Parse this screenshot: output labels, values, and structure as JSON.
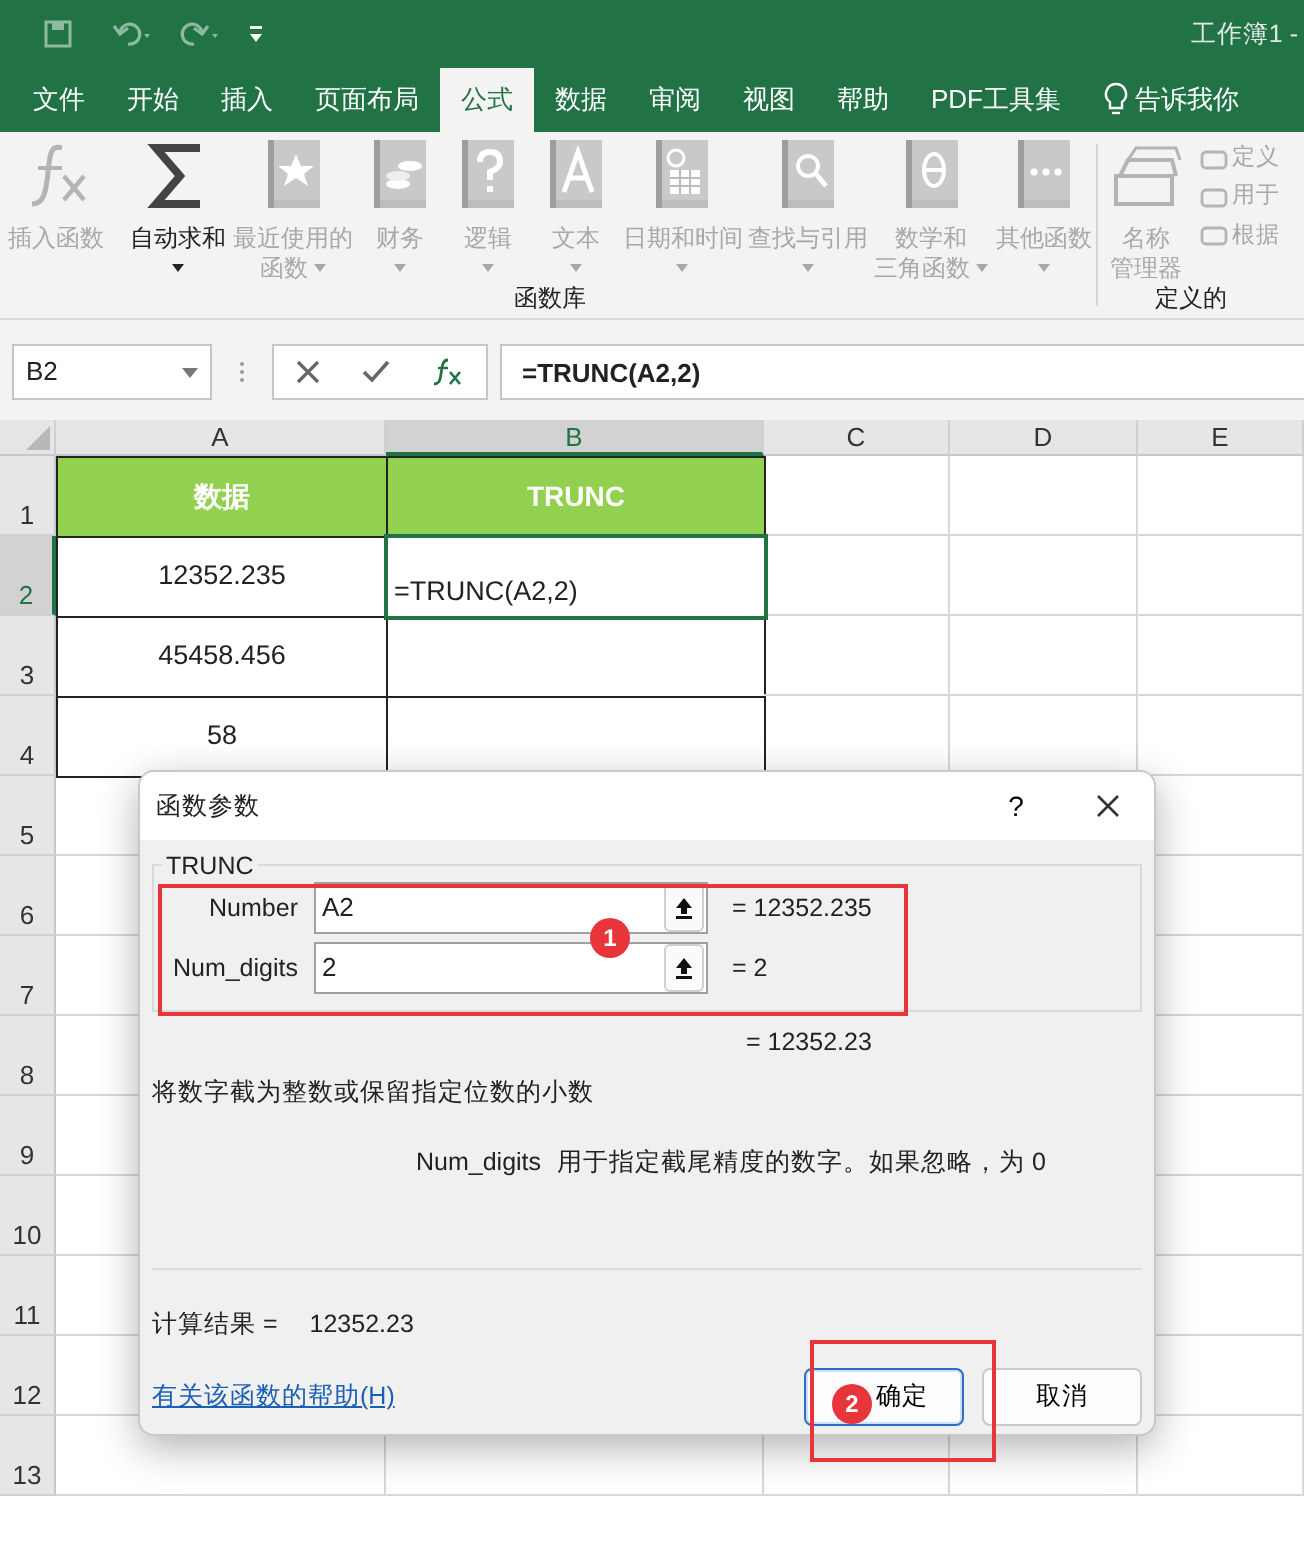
{
  "title_bar": {
    "title": "工作簿1 -"
  },
  "tabs": [
    {
      "label": "文件",
      "selected": false
    },
    {
      "label": "开始",
      "selected": false
    },
    {
      "label": "插入",
      "selected": false
    },
    {
      "label": "页面布局",
      "selected": false
    },
    {
      "label": "公式",
      "selected": true
    },
    {
      "label": "数据",
      "selected": false
    },
    {
      "label": "审阅",
      "selected": false
    },
    {
      "label": "视图",
      "selected": false
    },
    {
      "label": "帮助",
      "selected": false
    },
    {
      "label": "PDF工具集",
      "selected": false
    }
  ],
  "tell_me": {
    "label": "告诉我你"
  },
  "ribbon": {
    "groups": [
      {
        "label": "函数库",
        "buttons": [
          {
            "lines": [
              "插入函数"
            ],
            "disabled": true,
            "dropdown": false
          },
          {
            "lines": [
              "自动求和"
            ],
            "disabled": false,
            "dropdown": true
          },
          {
            "lines": [
              "最近使用的",
              "函数"
            ],
            "disabled": true,
            "dropdown": true
          },
          {
            "lines": [
              "财务"
            ],
            "disabled": true,
            "dropdown": true
          },
          {
            "lines": [
              "逻辑"
            ],
            "disabled": true,
            "dropdown": true
          },
          {
            "lines": [
              "文本"
            ],
            "disabled": true,
            "dropdown": true
          },
          {
            "lines": [
              "日期和时间"
            ],
            "disabled": true,
            "dropdown": true
          },
          {
            "lines": [
              "查找与引用"
            ],
            "disabled": true,
            "dropdown": true
          },
          {
            "lines": [
              "数学和",
              "三角函数"
            ],
            "disabled": true,
            "dropdown": true
          },
          {
            "lines": [
              "其他函数"
            ],
            "disabled": true,
            "dropdown": true
          }
        ]
      },
      {
        "label": "定义的",
        "buttons": [
          {
            "lines": [
              "名称",
              "管理器"
            ],
            "disabled": true,
            "dropdown": false
          }
        ],
        "small_buttons": [
          {
            "label": "定义",
            "disabled": true
          },
          {
            "label": "用于",
            "disabled": true
          },
          {
            "label": "根据",
            "disabled": true
          }
        ]
      }
    ]
  },
  "formula_bar": {
    "name_box": "B2",
    "formula": "=TRUNC(A2,2)"
  },
  "columns": [
    {
      "label": "A",
      "selected": false
    },
    {
      "label": "B",
      "selected": true
    },
    {
      "label": "C",
      "selected": false
    },
    {
      "label": "D",
      "selected": false
    },
    {
      "label": "E",
      "selected": false
    }
  ],
  "rows": [
    {
      "number": "1",
      "selected": false,
      "framed": true,
      "cells": [
        {
          "text": "数据",
          "kind": "header"
        },
        {
          "text": "TRUNC",
          "kind": "header"
        }
      ]
    },
    {
      "number": "2",
      "selected": true,
      "framed": true,
      "cells": [
        {
          "text": "12352.235",
          "kind": "value"
        },
        {
          "text": "=TRUNC(A2,2)",
          "kind": "editing",
          "selected": true
        }
      ]
    },
    {
      "number": "3",
      "selected": false,
      "framed": true,
      "cells": [
        {
          "text": "45458.456",
          "kind": "value"
        }
      ]
    },
    {
      "number": "4",
      "selected": false,
      "framed": true,
      "cells": [
        {
          "text": "58",
          "kind": "value"
        }
      ]
    },
    {
      "number": "5",
      "selected": false,
      "framed": false,
      "cells": []
    },
    {
      "number": "6",
      "selected": false,
      "framed": false,
      "cells": []
    },
    {
      "number": "7",
      "selected": false,
      "framed": false,
      "cells": []
    },
    {
      "number": "8",
      "selected": false,
      "framed": false,
      "cells": []
    },
    {
      "number": "9",
      "selected": false,
      "framed": false,
      "cells": []
    },
    {
      "number": "10",
      "selected": false,
      "framed": false,
      "cells": []
    },
    {
      "number": "11",
      "selected": false,
      "framed": false,
      "cells": []
    },
    {
      "number": "12",
      "selected": false,
      "framed": false,
      "cells": []
    },
    {
      "number": "13",
      "selected": false,
      "framed": false,
      "cells": []
    }
  ],
  "dialog": {
    "title": "函数参数",
    "help_button": "?",
    "function_name": "TRUNC",
    "arguments": [
      {
        "label": "Number",
        "value": "A2",
        "result": "= 12352.235"
      },
      {
        "label": "Num_digits",
        "value": "2",
        "result": "= 2"
      }
    ],
    "formula_result": "= 12352.23",
    "description": "将数字截为整数或保留指定位数的小数",
    "argument_help": {
      "name": "Num_digits",
      "text": "用于指定截尾精度的数字。如果忽略，为 0"
    },
    "calc_result_label": "计算结果 =",
    "calc_result": "12352.23",
    "help_link": "有关该函数的帮助(H)",
    "buttons": [
      {
        "label": "确定",
        "default": true
      },
      {
        "label": "取消",
        "default": false
      }
    ]
  },
  "annotations": [
    {
      "label": "1"
    },
    {
      "label": "2"
    }
  ]
}
